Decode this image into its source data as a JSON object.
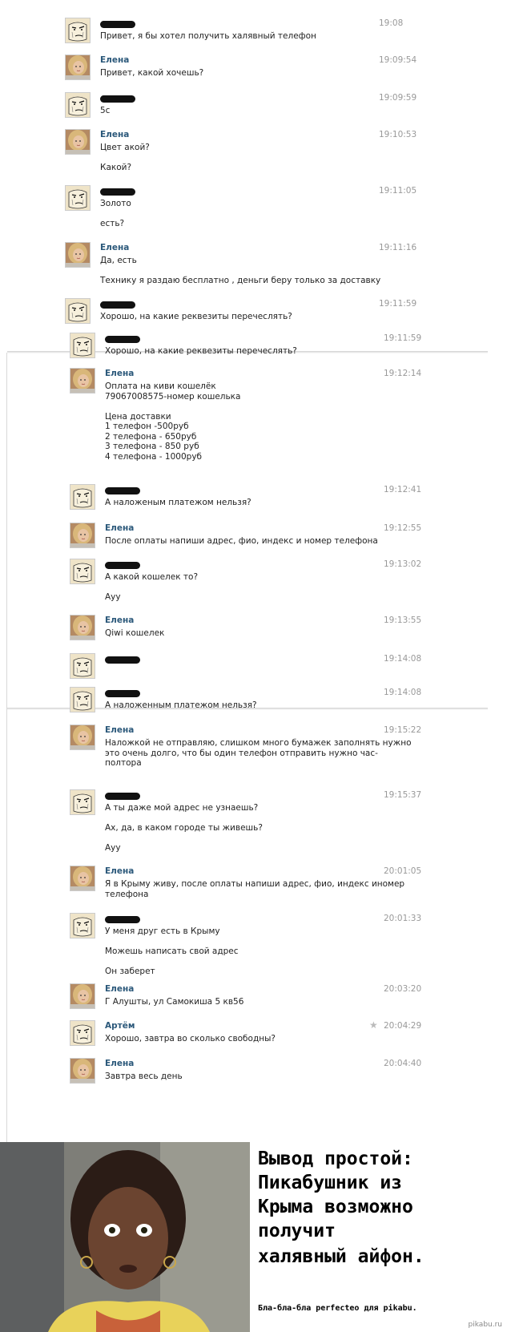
{
  "panel1": [
    {
      "sender": "",
      "time": "19:08",
      "lines": [
        "Привет, я бы хотел получить халявный телефон"
      ]
    },
    {
      "sender": "Елена",
      "time": "19:09:54",
      "lines": [
        "Привет, какой хочешь?"
      ]
    },
    {
      "sender": "",
      "time": "19:09:59",
      "lines": [
        "5с"
      ]
    },
    {
      "sender": "Елена",
      "time": "19:10:53",
      "lines": [
        "Цвет акой?",
        "",
        "Какой?"
      ]
    },
    {
      "sender": "",
      "time": "19:11:05",
      "lines": [
        "Золото",
        "",
        "есть?"
      ]
    },
    {
      "sender": "Елена",
      "time": "19:11:16",
      "lines": [
        "Да, есть",
        "",
        "Технику я раздаю бесплатно , деньги беру только за доставку"
      ]
    },
    {
      "sender": "",
      "time": "19:11:59",
      "lines": [
        "Хорошо, на какие реквезиты перечеслять?"
      ]
    }
  ],
  "panel2": [
    {
      "sender": "",
      "time": "19:11:59",
      "lines": [
        "Хорошо, на какие реквезиты перечеслять?"
      ]
    },
    {
      "sender": "Елена",
      "time": "19:12:14",
      "lines": [
        "Оплата на киви кошелёк",
        "79067008575-номер кошелька",
        "",
        "Цена доставки",
        "1 телефон -500руб",
        "2 телефона - 650руб",
        "3 телефона - 850 руб",
        "4 телефона - 1000руб"
      ]
    },
    {
      "sender": "",
      "time": "19:12:41",
      "lines": [
        "А наложеным платежом нельзя?"
      ]
    },
    {
      "sender": "Елена",
      "time": "19:12:55",
      "lines": [
        "После оплаты напиши адрес, фио, индекс и номер телефона"
      ]
    },
    {
      "sender": "",
      "time": "19:13:02",
      "lines": [
        "А какой кошелек то?",
        "",
        "Ауу"
      ]
    },
    {
      "sender": "Елена",
      "time": "19:13:55",
      "lines": [
        "Qiwi кошелек"
      ]
    },
    {
      "sender": "",
      "time": "19:14:08",
      "lines": []
    }
  ],
  "panel3": [
    {
      "sender": "",
      "time": "19:14:08",
      "lines": [
        "А наложенным платежом нельзя?"
      ]
    },
    {
      "sender": "Елена",
      "time": "19:15:22",
      "lines": [
        "Наложкой не отправляю, слишком много бумажек заполнять нужно",
        "это очень долго, что бы один телефон отправить нужно час-",
        "полтора"
      ]
    },
    {
      "sender": "",
      "time": "19:15:37",
      "lines": [
        "А ты даже мой адрес не узнаешь?",
        "",
        "Ах, да, в каком городе ты живешь?",
        "",
        "Ауу"
      ]
    },
    {
      "sender": "Елена",
      "time": "20:01:05",
      "lines": [
        "Я в Крыму живу, после оплаты напиши адрес, фио, индекс иномер",
        "телефона"
      ]
    },
    {
      "sender": "",
      "time": "20:01:33",
      "lines": [
        "У меня друг есть в Крыму",
        "",
        "Можешь написать свой адрес",
        "",
        "Он заберет"
      ]
    },
    {
      "sender": "Елена",
      "time": "20:03:20",
      "lines": [
        "Г Алушты, ул Самокиша 5 кв56"
      ]
    },
    {
      "sender": "Артём",
      "time": "20:04:29",
      "lines": [
        "Хорошо, завтра во сколько свободны?"
      ],
      "star": "★"
    },
    {
      "sender": "Елена",
      "time": "20:04:40",
      "lines": [
        "Завтра весь день"
      ]
    }
  ],
  "meme": {
    "lines": [
      "Вывод простой:",
      "Пикабушник из",
      "Крыма возможно",
      "получит",
      "халявный айфон."
    ],
    "subtitle": "Бла-бла-бла perfecteo для pikabu.",
    "watermark": "pikabu.ru"
  }
}
